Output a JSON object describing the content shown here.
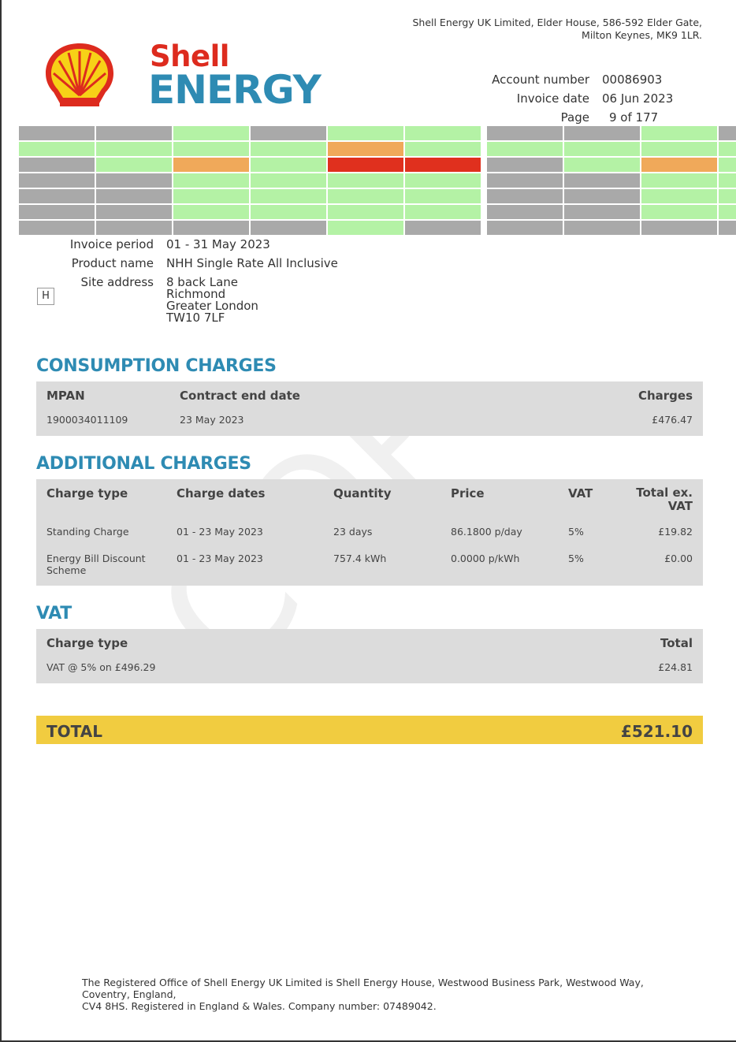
{
  "header": {
    "company_address_line1": "Shell Energy UK Limited, Elder House, 586-592 Elder Gate,",
    "company_address_line2": "Milton Keynes, MK9 1LR.",
    "brand_line1": "Shell",
    "brand_line2": "ENERGY",
    "logo_icon": "shell-pecten-icon",
    "account_number_label": "Account number",
    "account_number": "00086903",
    "invoice_date_label": "Invoice date",
    "invoice_date": "06 Jun 2023",
    "page_label": "Page",
    "page_value": "9 of 177"
  },
  "heatmap": {
    "colors": {
      "grey": "#a9a9a9",
      "green": "#b4f2a5",
      "orange": "#f0a95a",
      "red": "#e0301e"
    },
    "grid": [
      [
        "grey",
        "grey",
        "green",
        "grey",
        "green",
        "green",
        null,
        "grey",
        "grey",
        "green",
        "grey"
      ],
      [
        "green",
        "green",
        "green",
        "green",
        "orange",
        "green",
        null,
        "green",
        "green",
        "green",
        "green"
      ],
      [
        "grey",
        "green",
        "orange",
        "green",
        "red",
        "red",
        null,
        "grey",
        "green",
        "orange",
        "green"
      ],
      [
        "grey",
        "grey",
        "green",
        "green",
        "green",
        "green",
        null,
        "grey",
        "grey",
        "green",
        "green"
      ],
      [
        "grey",
        "grey",
        "green",
        "green",
        "green",
        "green",
        null,
        "grey",
        "grey",
        "green",
        "green"
      ],
      [
        "grey",
        "grey",
        "green",
        "green",
        "green",
        "green",
        null,
        "grey",
        "grey",
        "green",
        "green"
      ],
      [
        "grey",
        "grey",
        "grey",
        "grey",
        "green",
        "grey",
        null,
        "grey",
        "grey",
        "grey",
        "grey"
      ]
    ]
  },
  "details": {
    "invoice_period_label": "Invoice period",
    "invoice_period": "01 - 31 May 2023",
    "product_name_label": "Product name",
    "product_name": "NHH Single Rate All Inclusive",
    "site_address_label": "Site address",
    "site_address": [
      "8 back Lane",
      "Richmond",
      "Greater London",
      "TW10 7LF"
    ],
    "h_box": "H"
  },
  "consumption": {
    "title": "CONSUMPTION CHARGES",
    "headers": {
      "mpan": "MPAN",
      "contract_end": "Contract end date",
      "charges": "Charges"
    },
    "row": {
      "mpan": "1900034011109",
      "contract_end": "23 May 2023",
      "charges": "£476.47"
    }
  },
  "additional": {
    "title": "ADDITIONAL CHARGES",
    "headers": {
      "type": "Charge type",
      "dates": "Charge dates",
      "quantity": "Quantity",
      "price": "Price",
      "vat": "VAT",
      "total_1": "Total ex.",
      "total_2": "VAT"
    },
    "rows": [
      {
        "type": "Standing Charge",
        "type_2": "",
        "dates": "01 - 23 May 2023",
        "quantity": "23 days",
        "price": "86.1800 p/day",
        "vat": "5%",
        "total": "£19.82"
      },
      {
        "type": "Energy Bill Discount",
        "type_2": "Scheme",
        "dates": "01 - 23 May 2023",
        "quantity": "757.4 kWh",
        "price": "0.0000 p/kWh",
        "vat": "5%",
        "total": "£0.00"
      }
    ]
  },
  "vat": {
    "title": "VAT",
    "headers": {
      "type": "Charge type",
      "total": "Total"
    },
    "row": {
      "type": "VAT @ 5% on £496.29",
      "total": "£24.81"
    }
  },
  "total": {
    "label": "TOTAL",
    "value": "£521.10"
  },
  "watermark": {
    "text": "COPY"
  },
  "footer": {
    "line1": "The Registered Office of Shell Energy UK Limited is Shell Energy House, Westwood Business Park, Westwood Way, Coventry, England,",
    "line2": "CV4 8HS. Registered in England & Wales. Company number: 07489042."
  }
}
